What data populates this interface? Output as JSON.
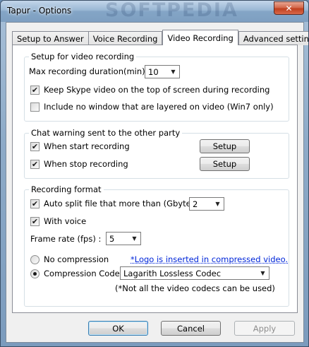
{
  "window": {
    "title": "Tapur - Options",
    "watermark": "SOFTPEDIA",
    "close_glyph": "✕"
  },
  "tabs": [
    {
      "label": "Setup to Answer",
      "active": false
    },
    {
      "label": "Voice Recording",
      "active": false
    },
    {
      "label": "Video Recording",
      "active": true
    },
    {
      "label": "Advanced setting",
      "active": false
    }
  ],
  "setup_group": {
    "title": "Setup for video recording",
    "max_duration_label": "Max recording duration(min):",
    "max_duration_value": "10",
    "keep_on_top_label": "Keep Skype video on the top of screen during recording",
    "keep_on_top_checked": true,
    "include_no_window_label": "Include no window that are layered on video (Win7 only)",
    "include_no_window_checked": false
  },
  "chat_group": {
    "title": "Chat warning sent to the other party",
    "start_label": "When start recording",
    "start_checked": true,
    "stop_label": "When stop recording",
    "stop_checked": true,
    "setup_button": "Setup"
  },
  "format_group": {
    "title": "Recording format",
    "auto_split_label": "Auto split file that more than (Gbyte) :",
    "auto_split_checked": true,
    "auto_split_value": "2",
    "with_voice_label": "With voice",
    "with_voice_checked": true,
    "frame_rate_label": "Frame rate (fps) :",
    "frame_rate_value": "5",
    "no_compression_label": "No compression",
    "logo_note": "*Logo is inserted in compressed video.",
    "compression_label": "Compression Codec",
    "codec_value": "Lagarith Lossless Codec",
    "codec_note": "(*Not all the video codecs can be used)",
    "selected": "compression"
  },
  "footer": {
    "ok": "OK",
    "cancel": "Cancel",
    "apply": "Apply"
  },
  "glyphs": {
    "check": "✔",
    "dropdown": "▼"
  }
}
